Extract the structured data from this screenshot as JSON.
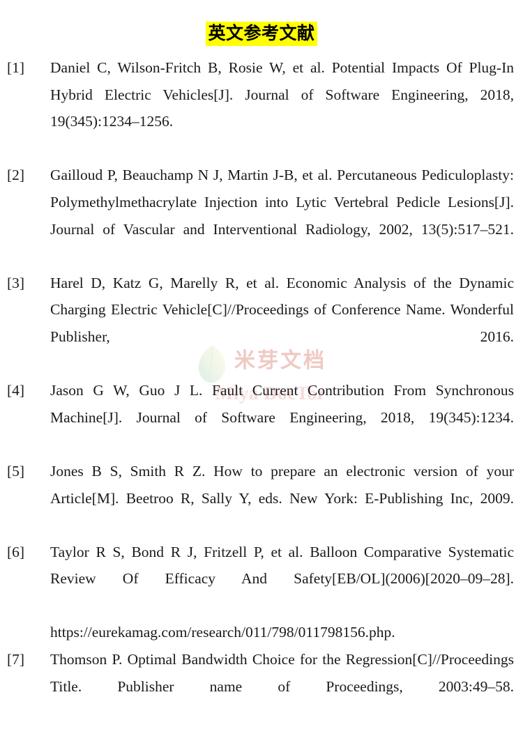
{
  "document": {
    "title": "英文参考文献",
    "title_highlight_color": "#ffff00",
    "background_color": "#ffffff",
    "text_color": "#1a1a1a"
  },
  "watermark": {
    "chinese_text": "米芽文档",
    "english_text": "Miya DocTor",
    "color": "#f0c9c4",
    "logo": "leaf-icon"
  },
  "references": [
    {
      "label": "[1]",
      "text": "Daniel C, Wilson-Fritch B, Rosie W, et al. Potential Impacts Of Plug-In Hybrid Electric Vehicles[J]. Journal of Software Engineering, 2018, 19(345):1234–1256."
    },
    {
      "label": "[2]",
      "text": "Gailloud P, Beauchamp N J, Martin J-B, et al. Percutaneous Pediculoplasty: Polymethylmethacrylate Injection into Lytic Vertebral Pedicle Lesions[J]. Journal of Vascular and Interventional Radiology, 2002, 13(5):517–521."
    },
    {
      "label": "[3]",
      "text": "Harel D, Katz G, Marelly R, et al. Economic Analysis of the Dynamic Charging Electric Vehicle[C]//Proceedings of Conference Name. Wonderful Publisher, 2016."
    },
    {
      "label": "[4]",
      "text": "Jason G W, Guo J L. Fault Current Contribution From Synchronous Machine[J]. Journal of Software Engineering, 2018, 19(345):1234."
    },
    {
      "label": "[5]",
      "text": "Jones B S, Smith R Z. How to prepare an electronic version of your Article[M]. Beetroo R, Sally Y, eds. New York: E-Publishing Inc, 2009."
    },
    {
      "label": "[6]",
      "text": "Taylor R S, Bond R J, Fritzell P, et al. Balloon Comparative Systematic Review Of Efficacy And Safety[EB/OL](2006)[2020–09–28].",
      "url": "https://eurekamag.com/research/011/798/011798156.php."
    },
    {
      "label": "[7]",
      "text": "Thomson P. Optimal Bandwidth Choice for the Regression[C]//Proceedings Title. Publisher name of Proceedings, 2003:49–58."
    }
  ]
}
